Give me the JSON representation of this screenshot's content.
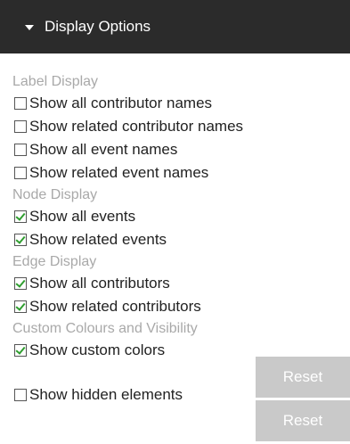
{
  "header": {
    "title": "Display Options",
    "caret_icon": "caret-down-icon"
  },
  "sections": {
    "label_display": {
      "heading": "Label Display",
      "options": [
        {
          "label": "Show all contributor names",
          "checked": false
        },
        {
          "label": "Show related contributor names",
          "checked": false
        },
        {
          "label": "Show all event names",
          "checked": false
        },
        {
          "label": "Show related event names",
          "checked": false
        }
      ]
    },
    "node_display": {
      "heading": "Node Display",
      "options": [
        {
          "label": "Show all events",
          "checked": true
        },
        {
          "label": "Show related events",
          "checked": true
        }
      ]
    },
    "edge_display": {
      "heading": "Edge Display",
      "options": [
        {
          "label": "Show all contributors",
          "checked": true
        },
        {
          "label": "Show related contributors",
          "checked": true
        }
      ]
    },
    "custom": {
      "heading": "Custom Colours and Visibility",
      "options": [
        {
          "label": "Show custom colors",
          "checked": true,
          "button": "Reset"
        },
        {
          "label": "Show hidden elements",
          "checked": false,
          "button": "Reset"
        }
      ]
    }
  },
  "colors": {
    "header_bg": "#2b2b2b",
    "section_label": "#a9a9a9",
    "check_mark": "#2f9e2f",
    "reset_button_bg": "#c9c9c9"
  }
}
